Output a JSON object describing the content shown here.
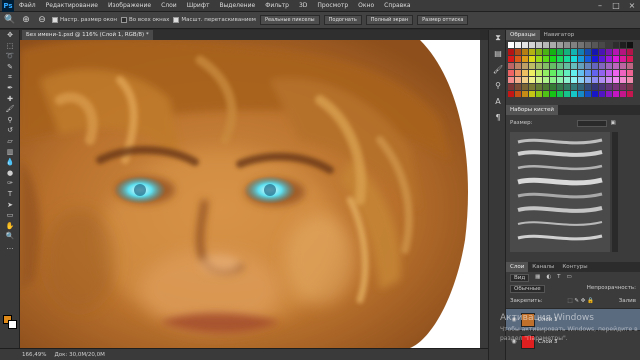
{
  "app": {
    "logo": "Ps"
  },
  "menu": [
    "Файл",
    "Редактирование",
    "Изображение",
    "Слои",
    "Шрифт",
    "Выделение",
    "Фильтр",
    "3D",
    "Просмотр",
    "Окно",
    "Справка"
  ],
  "options": {
    "checks": [
      {
        "label": "Настр. размер окон",
        "checked": true
      },
      {
        "label": "Во всех окнах",
        "checked": false
      },
      {
        "label": "Масшт. перетаскиванием",
        "checked": true
      }
    ],
    "buttons": [
      "Реальные пикселы",
      "Подогнать",
      "Полный экран",
      "Размер оттиска"
    ]
  },
  "document": {
    "tab_label": "Без имени-1.psd @ 116% (Слой 1, RGB/8) *"
  },
  "status": {
    "zoom": "166,49%",
    "doc_size": "Док: 30,0M/20,0M"
  },
  "panels": {
    "swatch_tabs": [
      "Образцы",
      "Навигатор"
    ],
    "brushes_title": "Наборы кистей",
    "brush_size_label": "Размер:",
    "layers_tabs": [
      "Слои",
      "Каналы",
      "Контуры"
    ],
    "filter_label": "Вид",
    "blend_mode": "Обычные",
    "opacity_label": "Непрозрачность:",
    "lock_label": "Закрепить:",
    "fill_label": "Залив",
    "layers": [
      {
        "name": "Слой 1",
        "active": true,
        "thumb_color": "#c0702a"
      },
      {
        "name": "Слой 3",
        "active": false,
        "thumb_color": "#e02020"
      }
    ]
  },
  "watermark": {
    "title": "Активация Windows",
    "subtitle": "Чтобы активировать Windows, перейдите в раздел \"Параметры\"."
  },
  "colors": {
    "foreground": "#e08a1a",
    "background": "#ffffff",
    "accent": "#31a8ff"
  }
}
